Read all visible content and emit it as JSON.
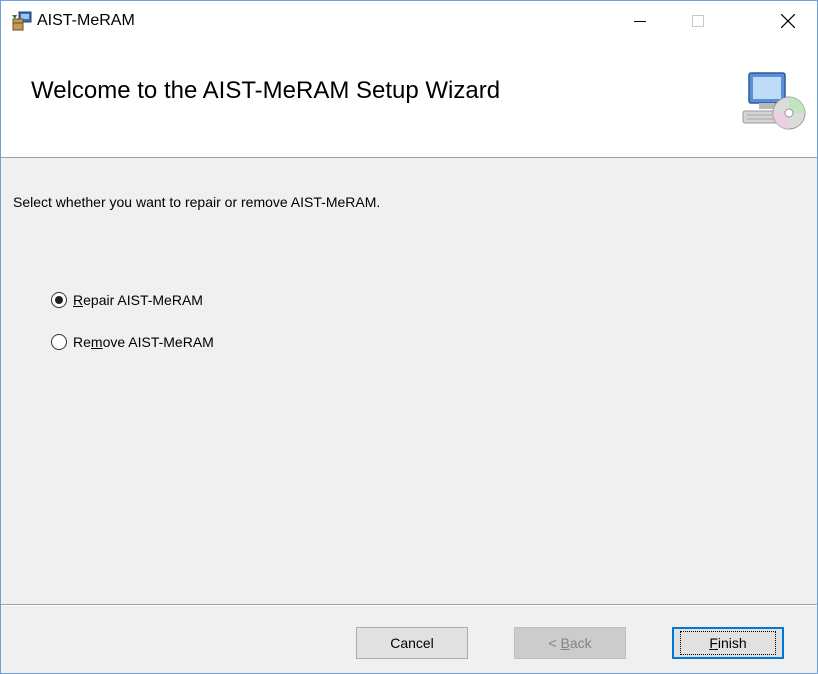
{
  "window": {
    "title": "AIST-MeRAM",
    "app_icon": "installer-package-icon"
  },
  "header": {
    "title": "Welcome to the AIST-MeRAM Setup Wizard",
    "icon": "computer-cd-icon"
  },
  "body": {
    "instruction": "Select whether you want to repair or remove AIST-MeRAM.",
    "options": [
      {
        "accel": "R",
        "rest": "epair AIST-MeRAM",
        "checked": true
      },
      {
        "pre": "Re",
        "accel": "m",
        "rest": "ove AIST-MeRAM",
        "checked": false
      }
    ]
  },
  "buttons": {
    "cancel": "Cancel",
    "back_prefix": "< ",
    "back_accel": "B",
    "back_rest": "ack",
    "finish_accel": "F",
    "finish_rest": "inish"
  }
}
